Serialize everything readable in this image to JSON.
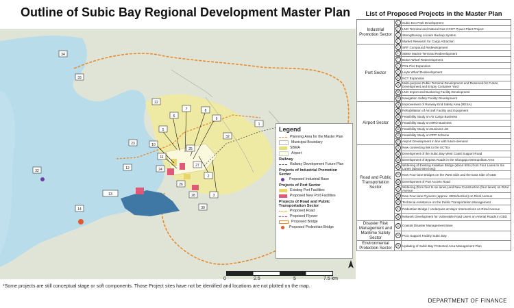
{
  "title": "Outline of Subic Bay Regional Development Master Plan",
  "legend": {
    "title": "Legend",
    "items": [
      {
        "label": "Planning Area for the Master Plan",
        "color": "#e88a2e"
      },
      {
        "label": "Municipal Boundary",
        "color": "#b7b7b7"
      },
      {
        "label": "SBMA",
        "color": "#e6e07a"
      },
      {
        "label": "Airport",
        "color": "#fdfde5"
      }
    ],
    "railway_heading": "Railway",
    "railway_label": "Railway Development Future Plan",
    "industrial_heading": "Projects of Industrial Promotion Sector",
    "industrial_label": "Proposed Industrial Base",
    "port_heading": "Projects of Port Sector",
    "port_items": [
      {
        "label": "Existing Port Facilities",
        "color": "#e8d66a"
      },
      {
        "label": "Proposed New Port Facilities",
        "color": "#e05a78"
      }
    ],
    "road_heading": "Projects of Road and Public Transportation Sector",
    "road_items": [
      "Proposed Road",
      "Proposed Flyover",
      "Proposed Bridge",
      "Proposed Pedestrian Bridge"
    ]
  },
  "scale": {
    "ticks": [
      "0",
      "2.5",
      "5",
      "7.5 km"
    ]
  },
  "north_label": "N",
  "footnote": "*Some projects are still conceptual stage or soft components. Those Project sites have not be identified and locations are not plotted on the map.",
  "department": "DEPARTMENT OF FINANCE",
  "panel": {
    "title": "List of Proposed Projects in the Master Plan",
    "sectors": [
      {
        "name": "Industrial Promotion Sector",
        "projects": [
          {
            "no": "1",
            "text": "Subic Eco-Park Development"
          },
          {
            "no": "2",
            "text": "LNG Terminal and Natural Gas CCGT Power Plant Project"
          },
          {
            "no": "3",
            "text": "Strengthening Locator Backup System"
          },
          {
            "no": "4",
            "text": "Market Research for Cargo Attraction"
          }
        ]
      },
      {
        "name": "Port Sector",
        "projects": [
          {
            "no": "5",
            "text": "SRF Compound Redevelopment"
          },
          {
            "no": "6",
            "text": "SBMA Marine Terminal Redevelopment"
          },
          {
            "no": "7",
            "text": "Boton Wharf Redevelopment"
          },
          {
            "no": "8",
            "text": "POL Pier Expansion"
          },
          {
            "no": "9",
            "text": "Leyte Wharf Redevelopment"
          },
          {
            "no": "10",
            "text": "NCT Expansion"
          },
          {
            "no": "11",
            "text": "Multi-purpose Public Terminal Development and Reserved for Future Development and Empty Container Yard"
          },
          {
            "no": "12",
            "text": "LNG Import and Bunkering Facility Development"
          },
          {
            "no": "13",
            "text": "Navigation Safety Facility Development"
          }
        ]
      },
      {
        "name": "Airport Sector",
        "projects": [
          {
            "no": "14",
            "text": "Improvement of Runway End Safety Area (RESA)"
          },
          {
            "no": "15",
            "text": "Rehabilitation of Aircraft Facility and Equipment"
          },
          {
            "no": "16",
            "text": "Feasibility Study on Air Cargo Business"
          },
          {
            "no": "17",
            "text": "Feasibility Study on MRO Business"
          },
          {
            "no": "18",
            "text": "Feasibility Study on Business Jet"
          },
          {
            "no": "19",
            "text": "Feasibility Study on PPP Scheme"
          },
          {
            "no": "20",
            "text": "Airport Development in line with future demand"
          }
        ]
      },
      {
        "name": "Road and Public Transportation Sector",
        "projects": [
          {
            "no": "21",
            "text": "New connecting link to the SCTEx"
          },
          {
            "no": "22",
            "text": "Development of the Subic Bay West Coast Support Road"
          },
          {
            "no": "23",
            "text": "Development of Bypass Roads in the Olongapo Metropolitan Area"
          },
          {
            "no": "24",
            "text": "Widening of Existing Kalaklan Bridge (about 60m) from Four Lanes to Six Lanes (about 60m long)"
          },
          {
            "no": "25",
            "text": "New Four-lane Bridges on the West Side and the East Side of CBD"
          },
          {
            "no": "26",
            "text": "Development of Port Access Road"
          },
          {
            "no": "27",
            "text": "Widening (from four to six lanes) and New Construction (four lanes) on Rizal Avenue"
          },
          {
            "no": "28",
            "text": "New Four-lane Flyovers (approx. 300m/section) on Rizal Avenue"
          },
          {
            "no": "29",
            "text": "Technical Assistance on the Public Transportation Management"
          },
          {
            "no": "30",
            "text": "Pedestrian Bridge / Underpass at Major Intersections on Rizal Avenue"
          },
          {
            "no": "31",
            "text": "Network Development for Vulnerable Road Users on Arterial Roads in CBD"
          }
        ]
      },
      {
        "name": "Disaster Risk Management and Maritime Safety Sector",
        "projects": [
          {
            "no": "32",
            "text": "Coastal Disaster Management Base"
          },
          {
            "no": "33",
            "text": "PCG Support Facility Subic Bay"
          }
        ]
      },
      {
        "name": "Environmental Protection Sector",
        "projects": [
          {
            "no": "34",
            "text": "Updating of Subic Bay Protected Area Management Plan"
          }
        ]
      }
    ]
  },
  "map_labels": [
    {
      "no": "1"
    },
    {
      "no": "2"
    },
    {
      "no": "3"
    },
    {
      "no": "5"
    },
    {
      "no": "6"
    },
    {
      "no": "7"
    },
    {
      "no": "8"
    },
    {
      "no": "9"
    },
    {
      "no": "10"
    },
    {
      "no": "11"
    },
    {
      "no": "12"
    },
    {
      "no": "13"
    },
    {
      "no": "14"
    },
    {
      "no": "21"
    },
    {
      "no": "22"
    },
    {
      "no": "23"
    },
    {
      "no": "24"
    },
    {
      "no": "25"
    },
    {
      "no": "26"
    },
    {
      "no": "27"
    },
    {
      "no": "28"
    },
    {
      "no": "30"
    },
    {
      "no": "32"
    },
    {
      "no": "33"
    },
    {
      "no": "34"
    }
  ],
  "colors": {
    "sea": "#b9dcea",
    "land": "#dfe4d6",
    "sbma": "#eeeaa4",
    "port_existing": "#e8d66a",
    "port_new": "#e05a78",
    "industrial": "#3f77a5",
    "planning_boundary": "#e88a2e"
  }
}
